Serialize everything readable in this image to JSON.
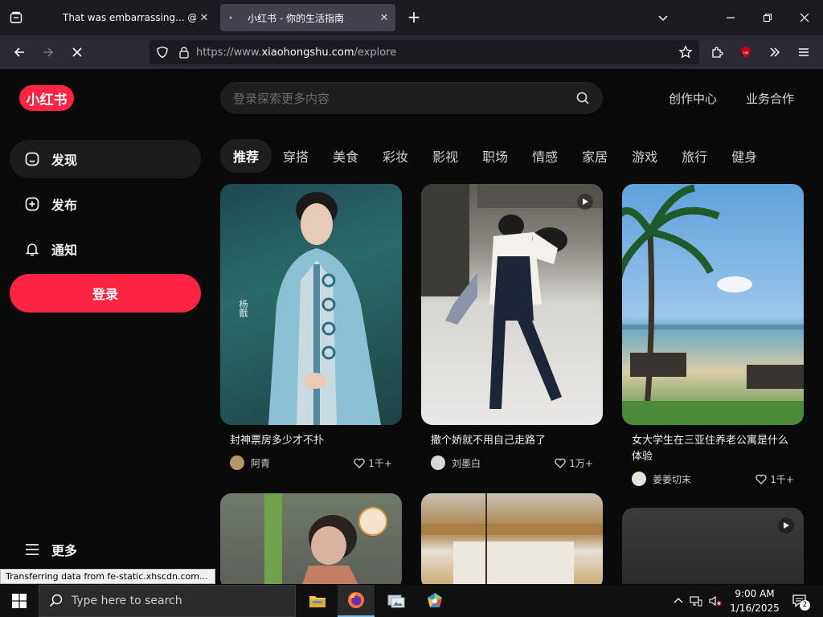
{
  "browser": {
    "tabs": [
      {
        "title": "That was embarrassing... @Infar",
        "active": false
      },
      {
        "title": "小红书 - 你的生活指南",
        "active": true
      }
    ],
    "url_prefix": "https://www.",
    "url_domain": "xiaohongshu.com",
    "url_path": "/explore",
    "status_text": "Transferring data from fe-static.xhscdn.com..."
  },
  "site": {
    "logo": "小红书",
    "search_placeholder": "登录探索更多内容",
    "header_links": [
      "创作中心",
      "业务合作"
    ],
    "sidebar": {
      "items": [
        {
          "label": "发现",
          "icon": "home-icon"
        },
        {
          "label": "发布",
          "icon": "plus-square-icon"
        },
        {
          "label": "通知",
          "icon": "bell-icon"
        }
      ],
      "login_label": "登录",
      "more_label": "更多"
    },
    "channels": [
      "推荐",
      "穿搭",
      "美食",
      "彩妆",
      "影视",
      "职场",
      "情感",
      "家居",
      "游戏",
      "旅行",
      "健身"
    ],
    "feed": [
      {
        "title": "封神票房多少才不扑",
        "author": "阿青",
        "likes": "1千+",
        "video": false
      },
      {
        "title": "撒个娇就不用自己走路了",
        "author": "刘墨白",
        "likes": "1万+",
        "video": true
      },
      {
        "title": "女大学生在三亚住养老公寓是什么体验",
        "author": "姜姜切末",
        "likes": "1千+",
        "video": false
      }
    ],
    "poster_text": "杨戬"
  },
  "taskbar": {
    "search_placeholder": "Type here to search",
    "time": "9:00 AM",
    "date": "1/16/2025",
    "notification_count": "2"
  },
  "colors": {
    "brand": "#ff2442",
    "tab_active": "#42414d",
    "page_bg": "#0a0a0a"
  }
}
